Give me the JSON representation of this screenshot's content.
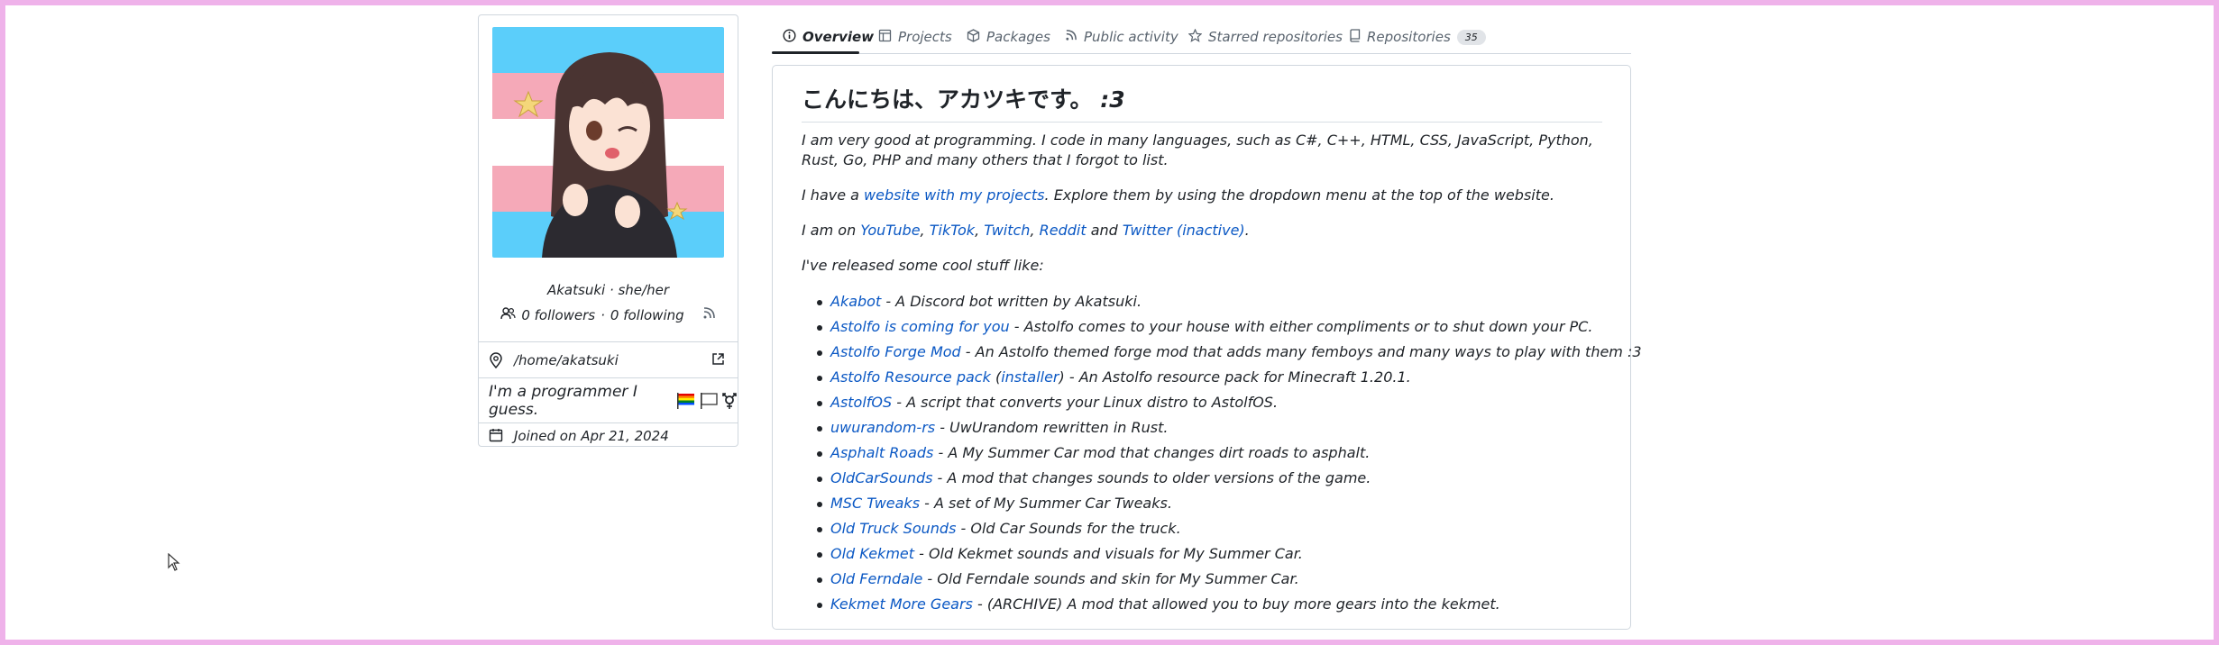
{
  "profile": {
    "name_line": "Akatsuki · she/her",
    "followers": "0 followers",
    "sep": "·",
    "following": "0 following",
    "location": "/home/akatsuki",
    "bio": "I'm a programmer I guess.",
    "joined": "Joined on Apr 21, 2024"
  },
  "tabs": [
    {
      "label": "Overview",
      "icon": "info-icon"
    },
    {
      "label": "Projects",
      "icon": "project-icon"
    },
    {
      "label": "Packages",
      "icon": "package-icon"
    },
    {
      "label": "Public activity",
      "icon": "rss-icon"
    },
    {
      "label": "Starred repositories",
      "icon": "star-icon"
    },
    {
      "label": "Repositories",
      "icon": "repo-icon",
      "count": "35"
    }
  ],
  "readme": {
    "heading": "こんにちは、アカツキです。",
    "heading_emph": ":3",
    "p1": "I am very good at programming. I code in many languages, such as C#, C++, HTML, CSS, JavaScript, Python, Rust, Go, PHP and many others that I forgot to list.",
    "p2_pre": "I have a ",
    "p2_link": "website with my projects",
    "p2_post": ". Explore them by using the dropdown menu at the top of the website.",
    "p3_pre": "I am on ",
    "p3_links": [
      "YouTube",
      "TikTok",
      "Twitch",
      "Reddit",
      "Twitter (inactive)"
    ],
    "p3_and": " and ",
    "p3_end": ".",
    "p4": "I've released some cool stuff like:",
    "items": [
      {
        "link": "Akabot",
        "text": " - A Discord bot written by Akatsuki."
      },
      {
        "link": "Astolfo is coming for you",
        "text": " - Astolfo comes to your house with either compliments or to shut down your PC."
      },
      {
        "link": "Astolfo Forge Mod",
        "text": " - An Astolfo themed forge mod that adds many femboys and many ways to play with them :3"
      },
      {
        "link": "Astolfo Resource pack",
        "text_mid": " (",
        "link2": "installer",
        "text": ") - An Astolfo resource pack for Minecraft 1.20.1."
      },
      {
        "link": "AstolfOS",
        "text": " - A script that converts your Linux distro to AstolfOS."
      },
      {
        "link": "uwurandom-rs",
        "text": " - UwUrandom rewritten in Rust."
      },
      {
        "link": "Asphalt Roads",
        "text": " - A My Summer Car mod that changes dirt roads to asphalt."
      },
      {
        "link": "OldCarSounds",
        "text": " - A mod that changes sounds to older versions of the game."
      },
      {
        "link": "MSC Tweaks",
        "text": " - A set of My Summer Car Tweaks."
      },
      {
        "link": "Old Truck Sounds",
        "text": " - Old Car Sounds for the truck."
      },
      {
        "link": "Old Kekmet",
        "text": " - Old Kekmet sounds and visuals for My Summer Car."
      },
      {
        "link": "Old Ferndale",
        "text": " - Old Ferndale sounds and skin for My Summer Car."
      },
      {
        "link": "Kekmet More Gears",
        "text": " - (ARCHIVE) A mod that allowed you to buy more gears into the kekmet."
      }
    ]
  },
  "colors": {
    "accent_link": "#0b58c4",
    "frame": "#efb2ea",
    "trans_blue": "#5bcefa",
    "trans_pink": "#f5a9b8"
  }
}
